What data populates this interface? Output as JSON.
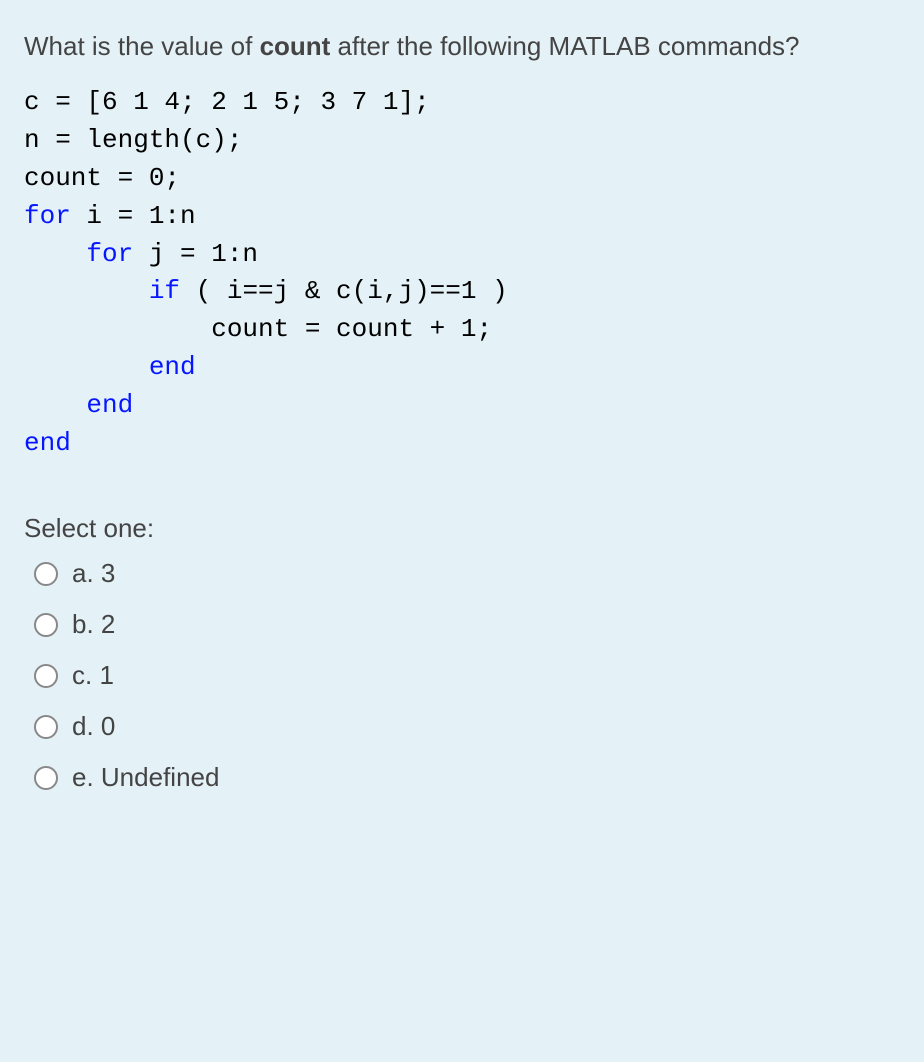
{
  "question": {
    "prefix": "What is the value of ",
    "bold": "count",
    "suffix": " after the following MATLAB commands?"
  },
  "code": {
    "l1a": "c = [6 1 4; 2 1 5; 3 7 1];",
    "l2a": "n = length(c);",
    "l3a": "count = 0;",
    "l4a": "for",
    "l4b": " i = 1:n",
    "l5a": "    for",
    "l5b": " j = 1:n",
    "l6a": "        if",
    "l6b": " ( i==j & c(i,j)==1 )",
    "l7a": "            count = count + 1;",
    "l8a": "        end",
    "l9a": "    end",
    "l10a": "end"
  },
  "select_label": "Select one:",
  "options": [
    {
      "label": "a. 3"
    },
    {
      "label": "b. 2"
    },
    {
      "label": "c. 1"
    },
    {
      "label": "d. 0"
    },
    {
      "label": "e. Undefined"
    }
  ]
}
